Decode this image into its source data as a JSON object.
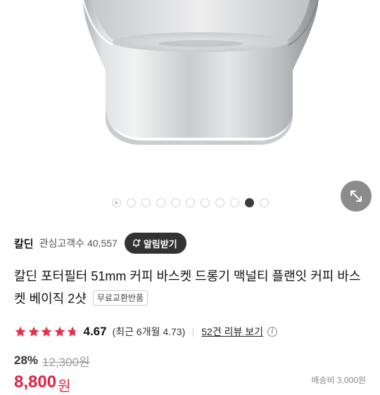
{
  "hero": {
    "image": "stainless-steel-filter-basket",
    "dot_count": 11,
    "active_index": 9,
    "zoom_icon": "expand-icon"
  },
  "brand": {
    "name": "칼딘",
    "interest_label": "관심고객수",
    "interest_count": "40,557",
    "notify_label": "알림받기",
    "notify_icon": "bell-plus-icon"
  },
  "product": {
    "title": "칼딘 포터필터 51mm 커피 바스켓 드롱기 맥널티 플랜잇 커피 바스켓 베이직 2샷",
    "badge": "무료교환반품"
  },
  "rating": {
    "stars": 4.67,
    "score": "4.67",
    "recent": "(최근 6개월 4.73)",
    "review_link": "52건 리뷰 보기",
    "star_color": "#e4304a"
  },
  "price": {
    "discount": "28%",
    "original": "12,300원",
    "sale": "8,800",
    "sale_unit": "원",
    "shipping": "배송비 3,000원"
  }
}
